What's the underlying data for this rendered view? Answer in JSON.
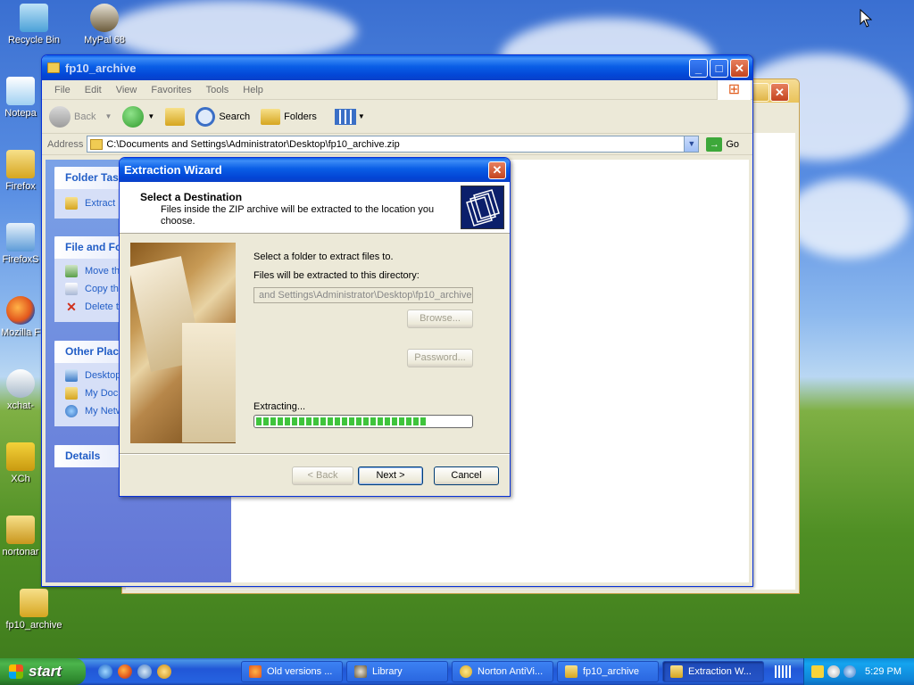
{
  "desktop_icons": [
    {
      "label": "Recycle Bin"
    },
    {
      "label": "MyPal 68"
    },
    {
      "label": "Notepa"
    },
    {
      "label": "Firefox"
    },
    {
      "label": "FirefoxS"
    },
    {
      "label": "Mozilla F"
    },
    {
      "label": "xchat-"
    },
    {
      "label": "XCh"
    },
    {
      "label": "nortonar"
    },
    {
      "label": "fp10_archive"
    }
  ],
  "explorer": {
    "title": "fp10_archive",
    "menu": [
      "File",
      "Edit",
      "View",
      "Favorites",
      "Tools",
      "Help"
    ],
    "toolbar": {
      "back": "Back",
      "search": "Search",
      "folders": "Folders"
    },
    "address_label": "Address",
    "address_value": "C:\\Documents and Settings\\Administrator\\Desktop\\fp10_archive.zip",
    "go": "Go",
    "task_pane": {
      "folder_tasks": {
        "title": "Folder Tas",
        "items": [
          "Extract"
        ]
      },
      "file_folder": {
        "title": "File and Fo",
        "items": [
          "Move th",
          "Copy th",
          "Delete t"
        ]
      },
      "other_places": {
        "title": "Other Plac",
        "items": [
          "Desktop",
          "My Doc",
          "My Netw"
        ]
      },
      "details": {
        "title": "Details"
      }
    }
  },
  "wizard": {
    "title": "Extraction Wizard",
    "heading": "Select a Destination",
    "subheading": "Files inside the ZIP archive will be extracted to the location you choose.",
    "prompt": "Select a folder to extract files to.",
    "dir_label": "Files will be extracted to this directory:",
    "dir_value": "and Settings\\Administrator\\Desktop\\fp10_archive",
    "browse": "Browse...",
    "password": "Password...",
    "extracting": "Extracting...",
    "progress": 0.79,
    "back": "< Back",
    "next": "Next >",
    "cancel": "Cancel"
  },
  "taskbar": {
    "start": "start",
    "tasks": [
      {
        "label": "Old versions ..."
      },
      {
        "label": "Library"
      },
      {
        "label": "Norton AntiVi..."
      },
      {
        "label": "fp10_archive"
      },
      {
        "label": "Extraction W...",
        "active": true
      }
    ],
    "clock": "5:29 PM"
  },
  "colors": {
    "xp_blue": "#0a5ee6",
    "link_blue": "#215dc6",
    "progress_green": "#3fc43c"
  }
}
